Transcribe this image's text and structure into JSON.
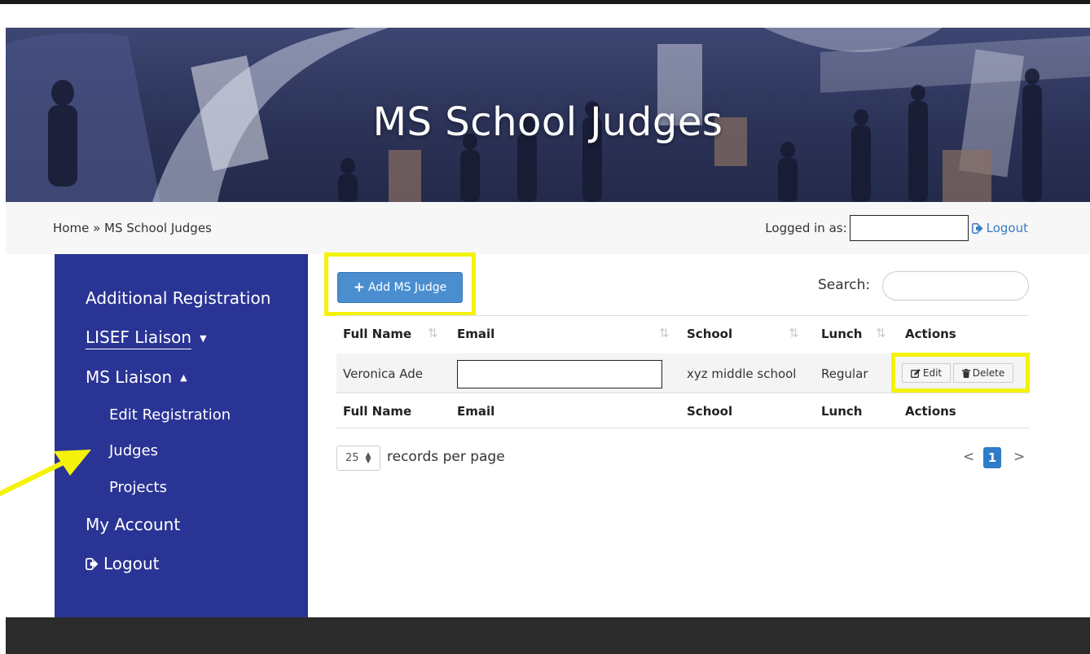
{
  "page": {
    "title": "MS School Judges"
  },
  "breadcrumb": {
    "home": "Home",
    "separator": "»",
    "current": "MS School Judges"
  },
  "header": {
    "logged_in_label": "Logged in as:",
    "logged_in_value": "",
    "logout_label": "Logout"
  },
  "sidebar": {
    "items": [
      {
        "label": "Additional Registration"
      },
      {
        "label": "LISEF Liaison",
        "caret": "▼"
      },
      {
        "label": "MS Liaison",
        "caret": "▲"
      },
      {
        "label": "Edit Registration"
      },
      {
        "label": "Judges"
      },
      {
        "label": "Projects"
      },
      {
        "label": "My Account"
      },
      {
        "label": "Logout"
      }
    ]
  },
  "toolbar": {
    "add_label": "Add MS Judge",
    "add_icon": "plus-icon"
  },
  "search": {
    "label": "Search:",
    "value": ""
  },
  "table": {
    "columns": [
      "Full Name",
      "Email",
      "School",
      "Lunch",
      "Actions"
    ],
    "rows": [
      {
        "full_name": "Veronica Ade",
        "email": "",
        "school": "xyz middle school",
        "lunch": "Regular"
      }
    ],
    "actions": {
      "edit": "Edit",
      "delete": "Delete"
    }
  },
  "pagination": {
    "page_size": "25",
    "records_label": "records per page",
    "prev": "<",
    "current": "1",
    "next": ">"
  },
  "colors": {
    "sidebar": "#2a3494",
    "accent": "#4a8ed0",
    "highlight": "#f4f20a",
    "footer": "#2b2b2b"
  }
}
